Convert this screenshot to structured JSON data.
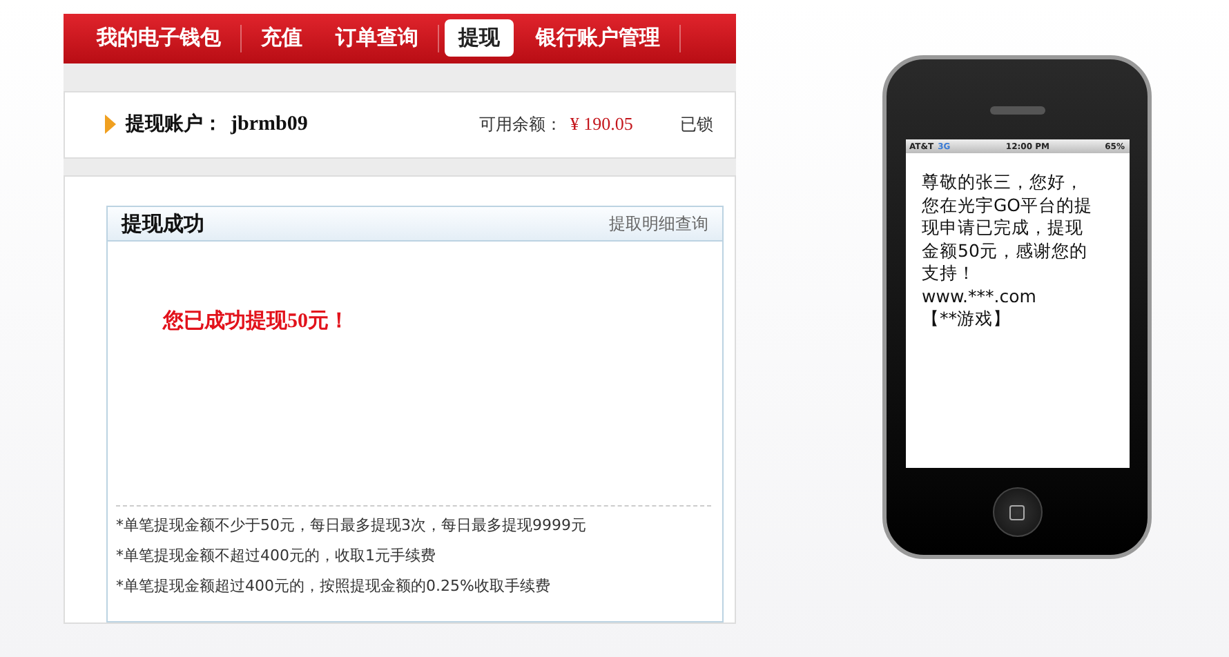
{
  "nav": {
    "tabs": [
      {
        "label": "我的电子钱包",
        "selected": false
      },
      {
        "label": "充值",
        "selected": false
      },
      {
        "label": "订单查询",
        "selected": false
      },
      {
        "label": "提现",
        "selected": true
      },
      {
        "label": "银行账户管理",
        "selected": false
      }
    ]
  },
  "account": {
    "label": "提现账户：",
    "value": "jbrmb09",
    "balance_label": "可用余额：",
    "balance": "¥ 190.05",
    "locked_label": "已锁"
  },
  "result": {
    "title": "提现成功",
    "link": "提取明细查询",
    "message": "您已成功提现50元！",
    "notes": [
      "*单笔提现金额不少于50元，每日最多提现3次，每日最多提现9999元",
      "*单笔提现金额不超过400元的，收取1元手续费",
      "*单笔提现金额超过400元的，按照提现金额的0.25%收取手续费"
    ]
  },
  "phone": {
    "status_bar": {
      "carrier": "AT&T",
      "network": "3G",
      "time": "12:00 PM",
      "battery": "65%"
    },
    "sms_lines": [
      "尊敬的张三，您好，",
      "您在光宇GO平台的提",
      "现申请已完成，提现",
      "金额50元，感谢您的",
      "支持！",
      "www.***.com",
      "【**游戏】"
    ]
  }
}
